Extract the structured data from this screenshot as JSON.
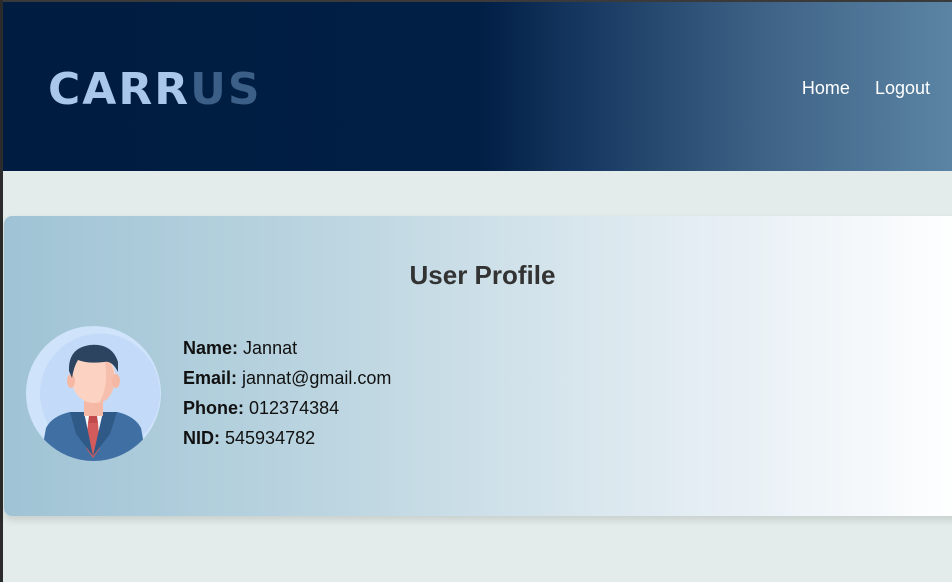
{
  "header": {
    "logo_part1": "CARR",
    "logo_part2": "US",
    "nav": [
      {
        "label": "Home"
      },
      {
        "label": "Logout"
      }
    ]
  },
  "profile": {
    "title": "User Profile",
    "avatar_icon": "user-avatar-icon",
    "fields": [
      {
        "label": "Name:",
        "value": "Jannat"
      },
      {
        "label": "Email:",
        "value": "jannat@gmail.com"
      },
      {
        "label": "Phone:",
        "value": "012374384"
      },
      {
        "label": "NID:",
        "value": "545934782"
      }
    ]
  },
  "colors": {
    "header_dark": "#001c40",
    "header_light": "#5b84a4",
    "logo_light": "#a9c7ea",
    "logo_dark": "#3b5f87",
    "page_bg": "#e3ecea"
  }
}
